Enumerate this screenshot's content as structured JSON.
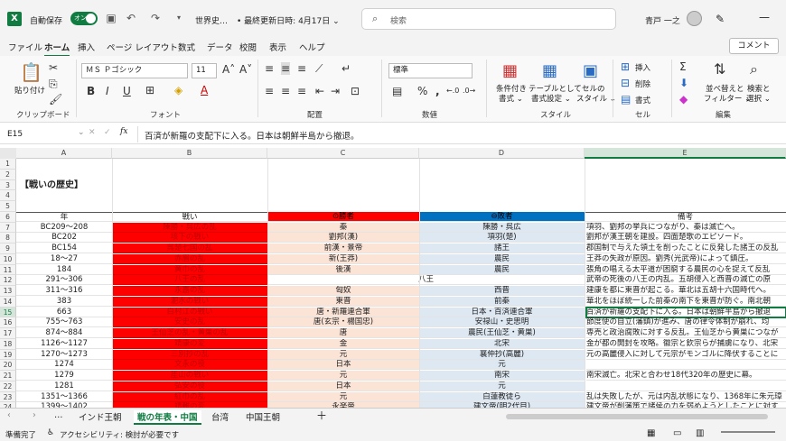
{
  "titlebar": {
    "autosave": "自動保存",
    "toggle": "オン",
    "doc_title": "世界史…",
    "saved": "• 最終更新日時: 4月17日 ⌄",
    "search_placeholder": "検索",
    "user": "青戸 一之"
  },
  "menu": [
    "ファイル",
    "ホーム",
    "挿入",
    "ページ レイアウト",
    "数式",
    "データ",
    "校閲",
    "表示",
    "ヘルプ"
  ],
  "comment": "コメント",
  "ribbon": {
    "paste": "貼り付け",
    "clipboard": "クリップボード",
    "font_name": "ＭＳ Ｐゴシック",
    "font_size": "11",
    "font": "フォント",
    "alignment": "配置",
    "number_format": "標準",
    "number": "数値",
    "cond_format": "条件付き",
    "cond_format2": "書式 ⌄",
    "table_format": "テーブルとして",
    "table_format2": "書式設定 ⌄",
    "cell_style": "セルの",
    "cell_style2": "スタイル ⌄",
    "style": "スタイル",
    "insert": "挿入",
    "delete": "削除",
    "format": "書式",
    "cells": "セル",
    "sort": "並べ替えと",
    "sort2": "フィルター ⌄",
    "find": "検索と",
    "find2": "選択 ⌄",
    "edit": "編集"
  },
  "formula": {
    "namebox": "E15",
    "fx": "fx",
    "content": "百済が新羅の支配下に入る。日本は朝鮮半島から撤退。"
  },
  "columns": [
    "A",
    "B",
    "C",
    "D",
    "E"
  ],
  "sheet_title": "【戦いの歴史】",
  "headers": {
    "year": "年",
    "battle": "戦い",
    "winner": "⊙勝者",
    "loser": "⊖敗者",
    "note": "備考"
  },
  "rows": [
    {
      "n": "7",
      "year": "BC209～208",
      "battle": "陳勝・呉広の乱",
      "winner": "秦",
      "loser": "陳勝・呉広",
      "note": "項羽、劉邦の挙兵につながり、秦は滅亡へ。"
    },
    {
      "n": "8",
      "year": "BC202",
      "battle": "垓下の戦い",
      "winner": "劉邦(漢)",
      "loser": "項羽(楚)",
      "note": "劉邦が漢王朝を建設。四面楚歌のエピソード。"
    },
    {
      "n": "9",
      "year": "BC154",
      "battle": "呉楚七国の乱",
      "winner": "前漢・景帝",
      "loser": "諸王",
      "note": "郡国制で与えた領土を削ったことに反発した諸王の反乱"
    },
    {
      "n": "10",
      "year": "18～27",
      "battle": "赤眉の乱",
      "winner": "新(王莽)",
      "loser": "農民",
      "note": "王莽の失政が原因。劉秀(光武帝)によって鎮圧。"
    },
    {
      "n": "11",
      "year": "184",
      "battle": "黄巾の乱",
      "winner": "後漢",
      "loser": "農民",
      "note": "張角の唱える太平道が困窮する農民の心を捉えて反乱"
    },
    {
      "n": "12",
      "year": "291～306",
      "battle": "八王の乱",
      "winner": "",
      "loser": "",
      "note": "武帝の死後の八王の内乱。五胡侵入と西晋の滅亡の原",
      "merged": "八王"
    },
    {
      "n": "13",
      "year": "311～316",
      "battle": "永嘉の乱",
      "winner": "匈奴",
      "loser": "西晋",
      "note": "建康を都に東晋が起こる。華北は五胡十六国時代へ。"
    },
    {
      "n": "14",
      "year": "383",
      "battle": "淝水の戦い",
      "winner": "東晋",
      "loser": "前秦",
      "note": "華北をほぼ統一した前秦の南下を東晋が防ぐ。南北朝"
    },
    {
      "n": "15",
      "year": "663",
      "battle": "白村江の戦い",
      "winner": "唐・新羅連合軍",
      "loser": "日本・百済連合軍",
      "note": "百済が新羅の支配下に入る。日本は朝鮮半島から撤退"
    },
    {
      "n": "16",
      "year": "755～763",
      "battle": "安史の乱",
      "winner": "唐(玄宗・楊国忠)",
      "loser": "安禄山・史思明",
      "note": "節度使の自立(藩鎮)が進み、唐の律令体制が崩れ、均"
    },
    {
      "n": "17",
      "year": "874～884",
      "battle": "王仙芝の乱・黄巣の乱",
      "winner": "唐",
      "loser": "農民(王仙芝・黄巣)",
      "note": "専売と政治腐敗に対する反乱。王仙芝から黄巣につなが"
    },
    {
      "n": "18",
      "year": "1126～1127",
      "battle": "靖康の変",
      "winner": "金",
      "loser": "北宋",
      "note": "金が都の開封を攻略。徽宗と欽宗らが捕虜になり、北宋"
    },
    {
      "n": "19",
      "year": "1270～1273",
      "battle": "三別抄の乱",
      "winner": "元",
      "loser": "襄仲抄(高麗)",
      "note": "元の高麗侵入に対して元宗がモンゴルに降伏することに"
    },
    {
      "n": "20",
      "year": "1274",
      "battle": "文永の役",
      "winner": "日本",
      "loser": "元",
      "note": ""
    },
    {
      "n": "21",
      "year": "1279",
      "battle": "厓山の戦い",
      "winner": "元",
      "loser": "南宋",
      "note": "南宋滅亡。北宋と合わせ18代320年の歴史に幕。"
    },
    {
      "n": "22",
      "year": "1281",
      "battle": "弘安の役",
      "winner": "日本",
      "loser": "元",
      "note": ""
    },
    {
      "n": "23",
      "year": "1351～1366",
      "battle": "紅巾の乱",
      "winner": "元",
      "loser": "白蓮教徒ら",
      "note": "乱は失敗したが、元は内乱状態になり、1368年に朱元璋"
    },
    {
      "n": "24",
      "year": "1399～1402",
      "battle": "靖難の変",
      "winner": "永楽帝",
      "loser": "建文帝(明2代目)",
      "note": "建文帝が削藩策で諸侯の力を弱めようとしたことに対す"
    }
  ],
  "sheets": [
    "インド王朝",
    "戦の年表・中国",
    "台湾",
    "中国王朝"
  ],
  "status": {
    "ready": "準備完了",
    "accessibility": "アクセシビリティ: 検討が必要です"
  },
  "colors": {
    "excel_green": "#107c41",
    "battle_red": "#ff0000",
    "winner_red": "#ff0000",
    "loser_blue": "#0070c0",
    "winner_bg": "#fbe3d6",
    "loser_bg": "#dde8f3"
  }
}
